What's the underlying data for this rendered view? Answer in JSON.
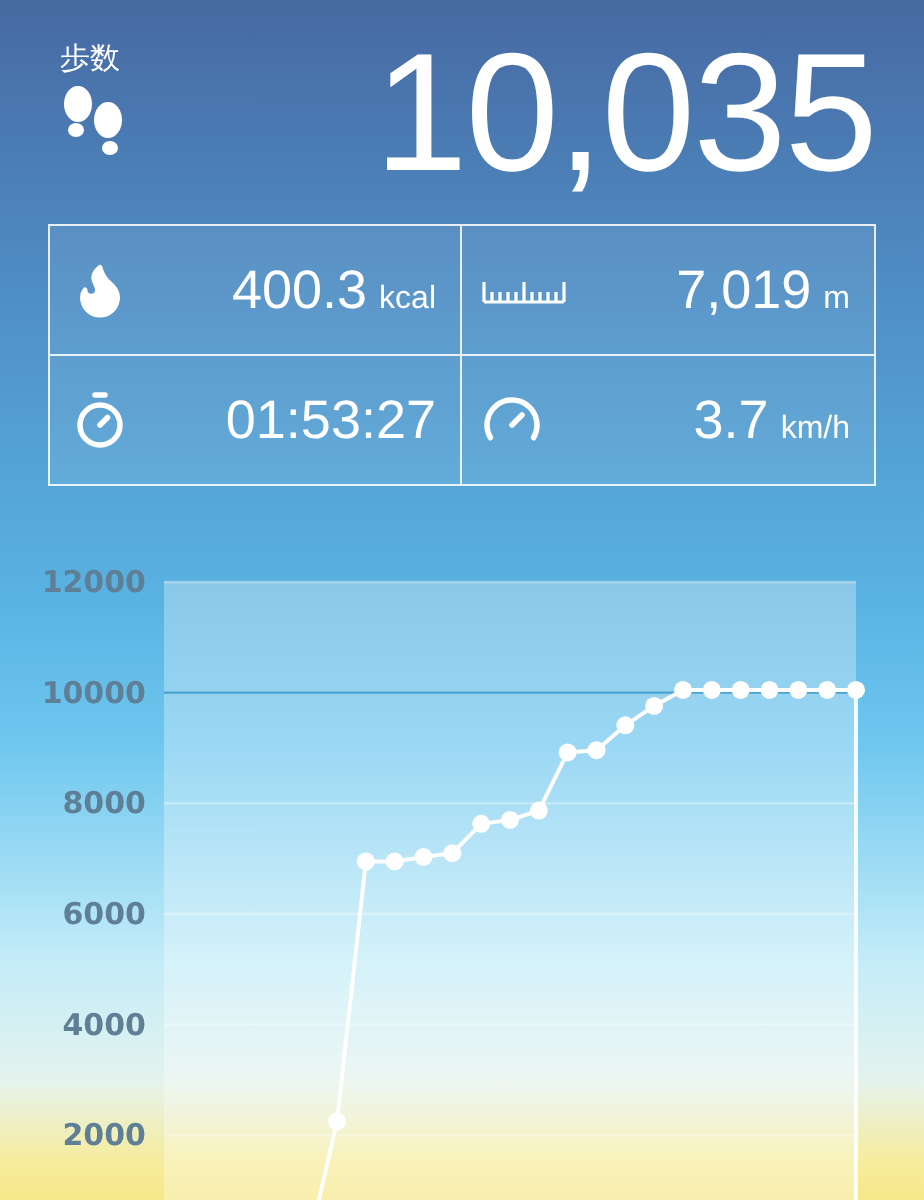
{
  "header": {
    "label": "歩数",
    "steps": "10,035"
  },
  "stats": [
    {
      "kind": "calories",
      "value": "400.3",
      "unit": "kcal"
    },
    {
      "kind": "distance",
      "value": "7,019",
      "unit": "m"
    },
    {
      "kind": "duration",
      "value": "01:53:27"
    },
    {
      "kind": "speed",
      "value": "3.7",
      "unit": "km/h"
    }
  ],
  "chart": {
    "chart_data": {
      "type": "line",
      "ylim": [
        0,
        12000
      ],
      "yticks": [
        2000,
        4000,
        6000,
        8000,
        10000,
        12000
      ],
      "grid": true,
      "ref_lines": [
        {
          "axis": "y",
          "value": 10000,
          "color": "#46a0d2"
        }
      ],
      "series": [
        {
          "color": "#ffffff",
          "marker": "circle",
          "values": [
            null,
            null,
            null,
            null,
            null,
            0,
            2250,
            6950,
            6950,
            7030,
            7100,
            7630,
            7700,
            7870,
            8920,
            8960,
            9410,
            9760,
            10050,
            10050,
            10050,
            10050,
            10050,
            10050,
            10050
          ]
        }
      ]
    }
  }
}
